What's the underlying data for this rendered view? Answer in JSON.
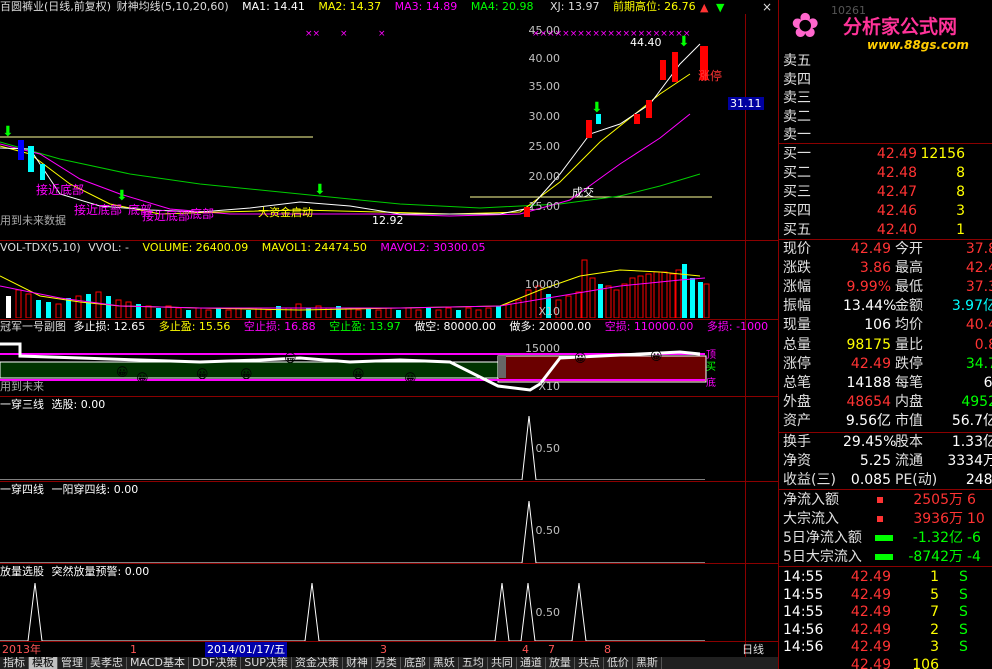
{
  "header": {
    "title": "百圆裤业(日线,前复权)",
    "indicator": "财神均线(5,10,20,60)",
    "ma1": "MA1: 14.41",
    "ma2": "MA2: 14.37",
    "ma3": "MA3: 14.89",
    "ma4": "MA4: 20.98",
    "xj": "XJ: 13.97",
    "prev_high": "前期高位: 26.76"
  },
  "logo": {
    "text": "分析家公式网",
    "url": "www.88gs.com",
    "prefix": "10261"
  },
  "main_chart": {
    "price_labels": [
      "45.00",
      "40.00",
      "35.00",
      "30.00",
      "25.00",
      "20.00",
      "15.00"
    ],
    "current_price_tag": "31.11",
    "annotations": [
      "接近底部",
      "接近底部",
      "底部",
      "接近底部",
      "底部",
      "大资金启动",
      "12.92",
      "44.40",
      "涨停",
      "成交",
      "用到未来数据"
    ]
  },
  "vol_panel": {
    "title": "VOL-TDX(5,10)",
    "wvol": "VVOL: -",
    "volume": "VOLUME: 26400.09",
    "mavol1": "MAVOL1: 24474.50",
    "mavol2": "MAVOL2: 30300.05",
    "axis_top": "10000",
    "axis_unit": "X10"
  },
  "pa_panel": {
    "title": "冠军一号副图",
    "stop_loss_long": "多止损: 12.65",
    "take_profit_long": "多止盈: 15.56",
    "stop_loss_short": "空止损: 16.88",
    "take_profit_short": "空止盈: 13.97",
    "short": "做空: 80000.00",
    "long": "做多: 20000.00",
    "short_loss": "空损: 110000.00",
    "long_loss": "多损: -1000",
    "axis_top": "15000",
    "axis_unit": "X10",
    "note": "用到未来",
    "side_labels": [
      "顶",
      "买",
      "底"
    ]
  },
  "panel3": {
    "title": "一穿三线",
    "sub": "选股: 0.00",
    "axis": "0.50"
  },
  "panel4": {
    "title": "一穿四线",
    "sub": "一阳穿四线: 0.00",
    "axis": "0.50"
  },
  "panel5": {
    "title": "放量选股",
    "sub": "突然放量预警: 0.00",
    "axis": "0.50"
  },
  "timeline": {
    "labels": [
      "2013年",
      "1",
      "2014/01/17/五",
      "3",
      "4",
      "7",
      "8"
    ],
    "period": "日线"
  },
  "tabs": [
    "指标",
    "模板",
    "管理",
    "吴孝忠",
    "MACD基本",
    "DDF决策",
    "SUP决策",
    "资金决策",
    "财神",
    "另类",
    "底部",
    "黑妖",
    "五均",
    "共同",
    "通道",
    "放量",
    "共点",
    "低价",
    "黑斯"
  ],
  "order_book": {
    "sell": [
      {
        "label": "卖五",
        "price": "",
        "vol": ""
      },
      {
        "label": "卖四",
        "price": "",
        "vol": ""
      },
      {
        "label": "卖三",
        "price": "",
        "vol": ""
      },
      {
        "label": "卖二",
        "price": "",
        "vol": ""
      },
      {
        "label": "卖一",
        "price": "",
        "vol": ""
      }
    ],
    "buy": [
      {
        "label": "买一",
        "price": "42.49",
        "vol": "12156"
      },
      {
        "label": "买二",
        "price": "42.48",
        "vol": "8"
      },
      {
        "label": "买三",
        "price": "42.47",
        "vol": "8"
      },
      {
        "label": "买四",
        "price": "42.46",
        "vol": "3"
      },
      {
        "label": "买五",
        "price": "42.40",
        "vol": "1"
      }
    ]
  },
  "quote": [
    {
      "k1": "现价",
      "v1": "42.49",
      "c1": "red",
      "k2": "今开",
      "v2": "37.8",
      "c2": "red"
    },
    {
      "k1": "涨跌",
      "v1": "3.86",
      "c1": "red",
      "k2": "最高",
      "v2": "42.4",
      "c2": "red"
    },
    {
      "k1": "涨幅",
      "v1": "9.99%",
      "c1": "red",
      "k2": "最低",
      "v2": "37.3",
      "c2": "red"
    },
    {
      "k1": "振幅",
      "v1": "13.44%",
      "c1": "white",
      "k2": "金额",
      "v2": "3.97亿",
      "c2": "cyan"
    },
    {
      "k1": "现量",
      "v1": "106",
      "c1": "white",
      "k2": "均价",
      "v2": "40.4",
      "c2": "red"
    },
    {
      "k1": "总量",
      "v1": "98175",
      "c1": "yellow",
      "k2": "量比",
      "v2": "0.8",
      "c2": "red"
    },
    {
      "k1": "涨停",
      "v1": "42.49",
      "c1": "red",
      "k2": "跌停",
      "v2": "34.7",
      "c2": "green"
    },
    {
      "k1": "总笔",
      "v1": "14188",
      "c1": "white",
      "k2": "每笔",
      "v2": "6.",
      "c2": "white"
    },
    {
      "k1": "外盘",
      "v1": "48654",
      "c1": "red",
      "k2": "内盘",
      "v2": "4952",
      "c2": "green"
    },
    {
      "k1": "资产",
      "v1": "9.56亿",
      "c1": "white",
      "k2": "市值",
      "v2": "56.7亿",
      "c2": "white"
    },
    {
      "k1": "换手",
      "v1": "29.45%",
      "c1": "white",
      "k2": "股本",
      "v2": "1.33亿",
      "c2": "white"
    },
    {
      "k1": "净资",
      "v1": "5.25",
      "c1": "white",
      "k2": "流通",
      "v2": "3334万",
      "c2": "white"
    },
    {
      "k1": "收益(三)",
      "v1": "0.085",
      "c1": "white",
      "k2": "PE(动)",
      "v2": "248.",
      "c2": "white"
    }
  ],
  "flows": [
    {
      "label": "净流入额",
      "value": "2505万",
      "extra": "6",
      "c": "red"
    },
    {
      "label": "大宗流入",
      "value": "3936万",
      "extra": "10",
      "c": "red"
    },
    {
      "label": "5日净流入额",
      "value": "-1.32亿",
      "extra": "-6",
      "c": "green"
    },
    {
      "label": "5日大宗流入",
      "value": "-8742万",
      "extra": "-4",
      "c": "green"
    }
  ],
  "ticks": [
    {
      "time": "14:55",
      "price": "42.49",
      "vol": "1",
      "bs": "S"
    },
    {
      "time": "14:55",
      "price": "42.49",
      "vol": "5",
      "bs": "S"
    },
    {
      "time": "14:55",
      "price": "42.49",
      "vol": "7",
      "bs": "S"
    },
    {
      "time": "14:56",
      "price": "42.49",
      "vol": "2",
      "bs": "S"
    },
    {
      "time": "14:56",
      "price": "42.49",
      "vol": "3",
      "bs": "S"
    },
    {
      "time": "",
      "price": "42.49",
      "vol": "106",
      "bs": ""
    }
  ]
}
